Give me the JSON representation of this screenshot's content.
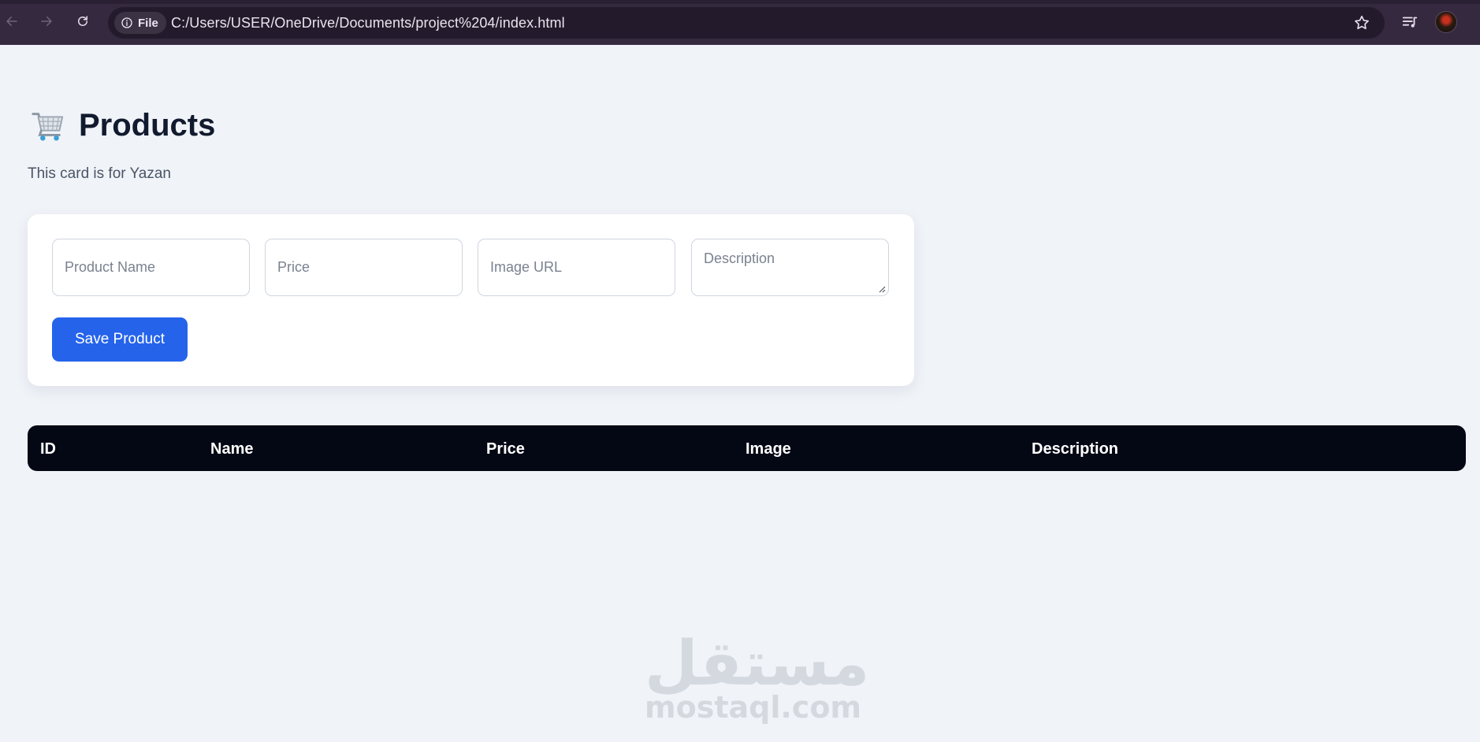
{
  "browser": {
    "chip_label": "File",
    "url": "C:/Users/USER/OneDrive/Documents/project%204/index.html"
  },
  "page": {
    "title": "Products",
    "subtitle": "This card is for Yazan"
  },
  "form": {
    "product_name_placeholder": "Product Name",
    "price_placeholder": "Price",
    "image_url_placeholder": "Image URL",
    "description_placeholder": "Description",
    "save_label": "Save Product"
  },
  "table": {
    "columns": [
      "ID",
      "Name",
      "Price",
      "Image",
      "Description"
    ]
  },
  "watermark": {
    "arabic": "مستقل",
    "latin": "mostaql.com"
  },
  "colors": {
    "accent": "#2563eb",
    "table_header": "#040714",
    "page_bg": "#f0f3f8",
    "chrome_bg": "#35293f"
  }
}
